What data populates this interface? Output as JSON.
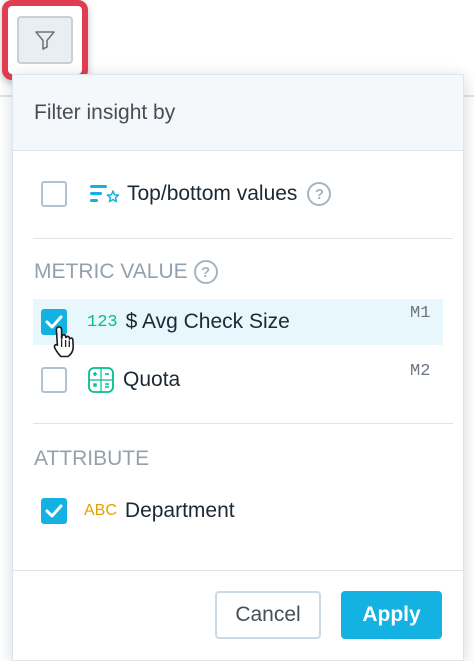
{
  "trigger": {
    "icon": "filter-funnel-icon"
  },
  "panel": {
    "title": "Filter insight by",
    "topbottom": {
      "label": "Top/bottom values",
      "checked": false,
      "icon": "ranking-icon",
      "help_icon": "help-icon"
    },
    "metric_section": {
      "title": "METRIC VALUE",
      "help_icon": "help-icon"
    },
    "metrics": [
      {
        "type_label": "123",
        "label": "$ Avg Check Size",
        "tag": "M1",
        "checked": true,
        "selected": true
      },
      {
        "type_label": "",
        "label": "Quota",
        "tag": "M2",
        "checked": false,
        "selected": false,
        "icon": "calculated-metric-icon"
      }
    ],
    "attribute_section": {
      "title": "ATTRIBUTE"
    },
    "attributes": [
      {
        "type_label": "ABC",
        "label": "Department",
        "checked": true
      }
    ],
    "buttons": {
      "cancel": "Cancel",
      "apply": "Apply"
    }
  },
  "colors": {
    "accent": "#14b2e2",
    "highlight_frame": "#e03e50",
    "numeric_type": "#00c18d",
    "text_type": "#e49f00"
  },
  "cursor": "hand-pointer-icon"
}
